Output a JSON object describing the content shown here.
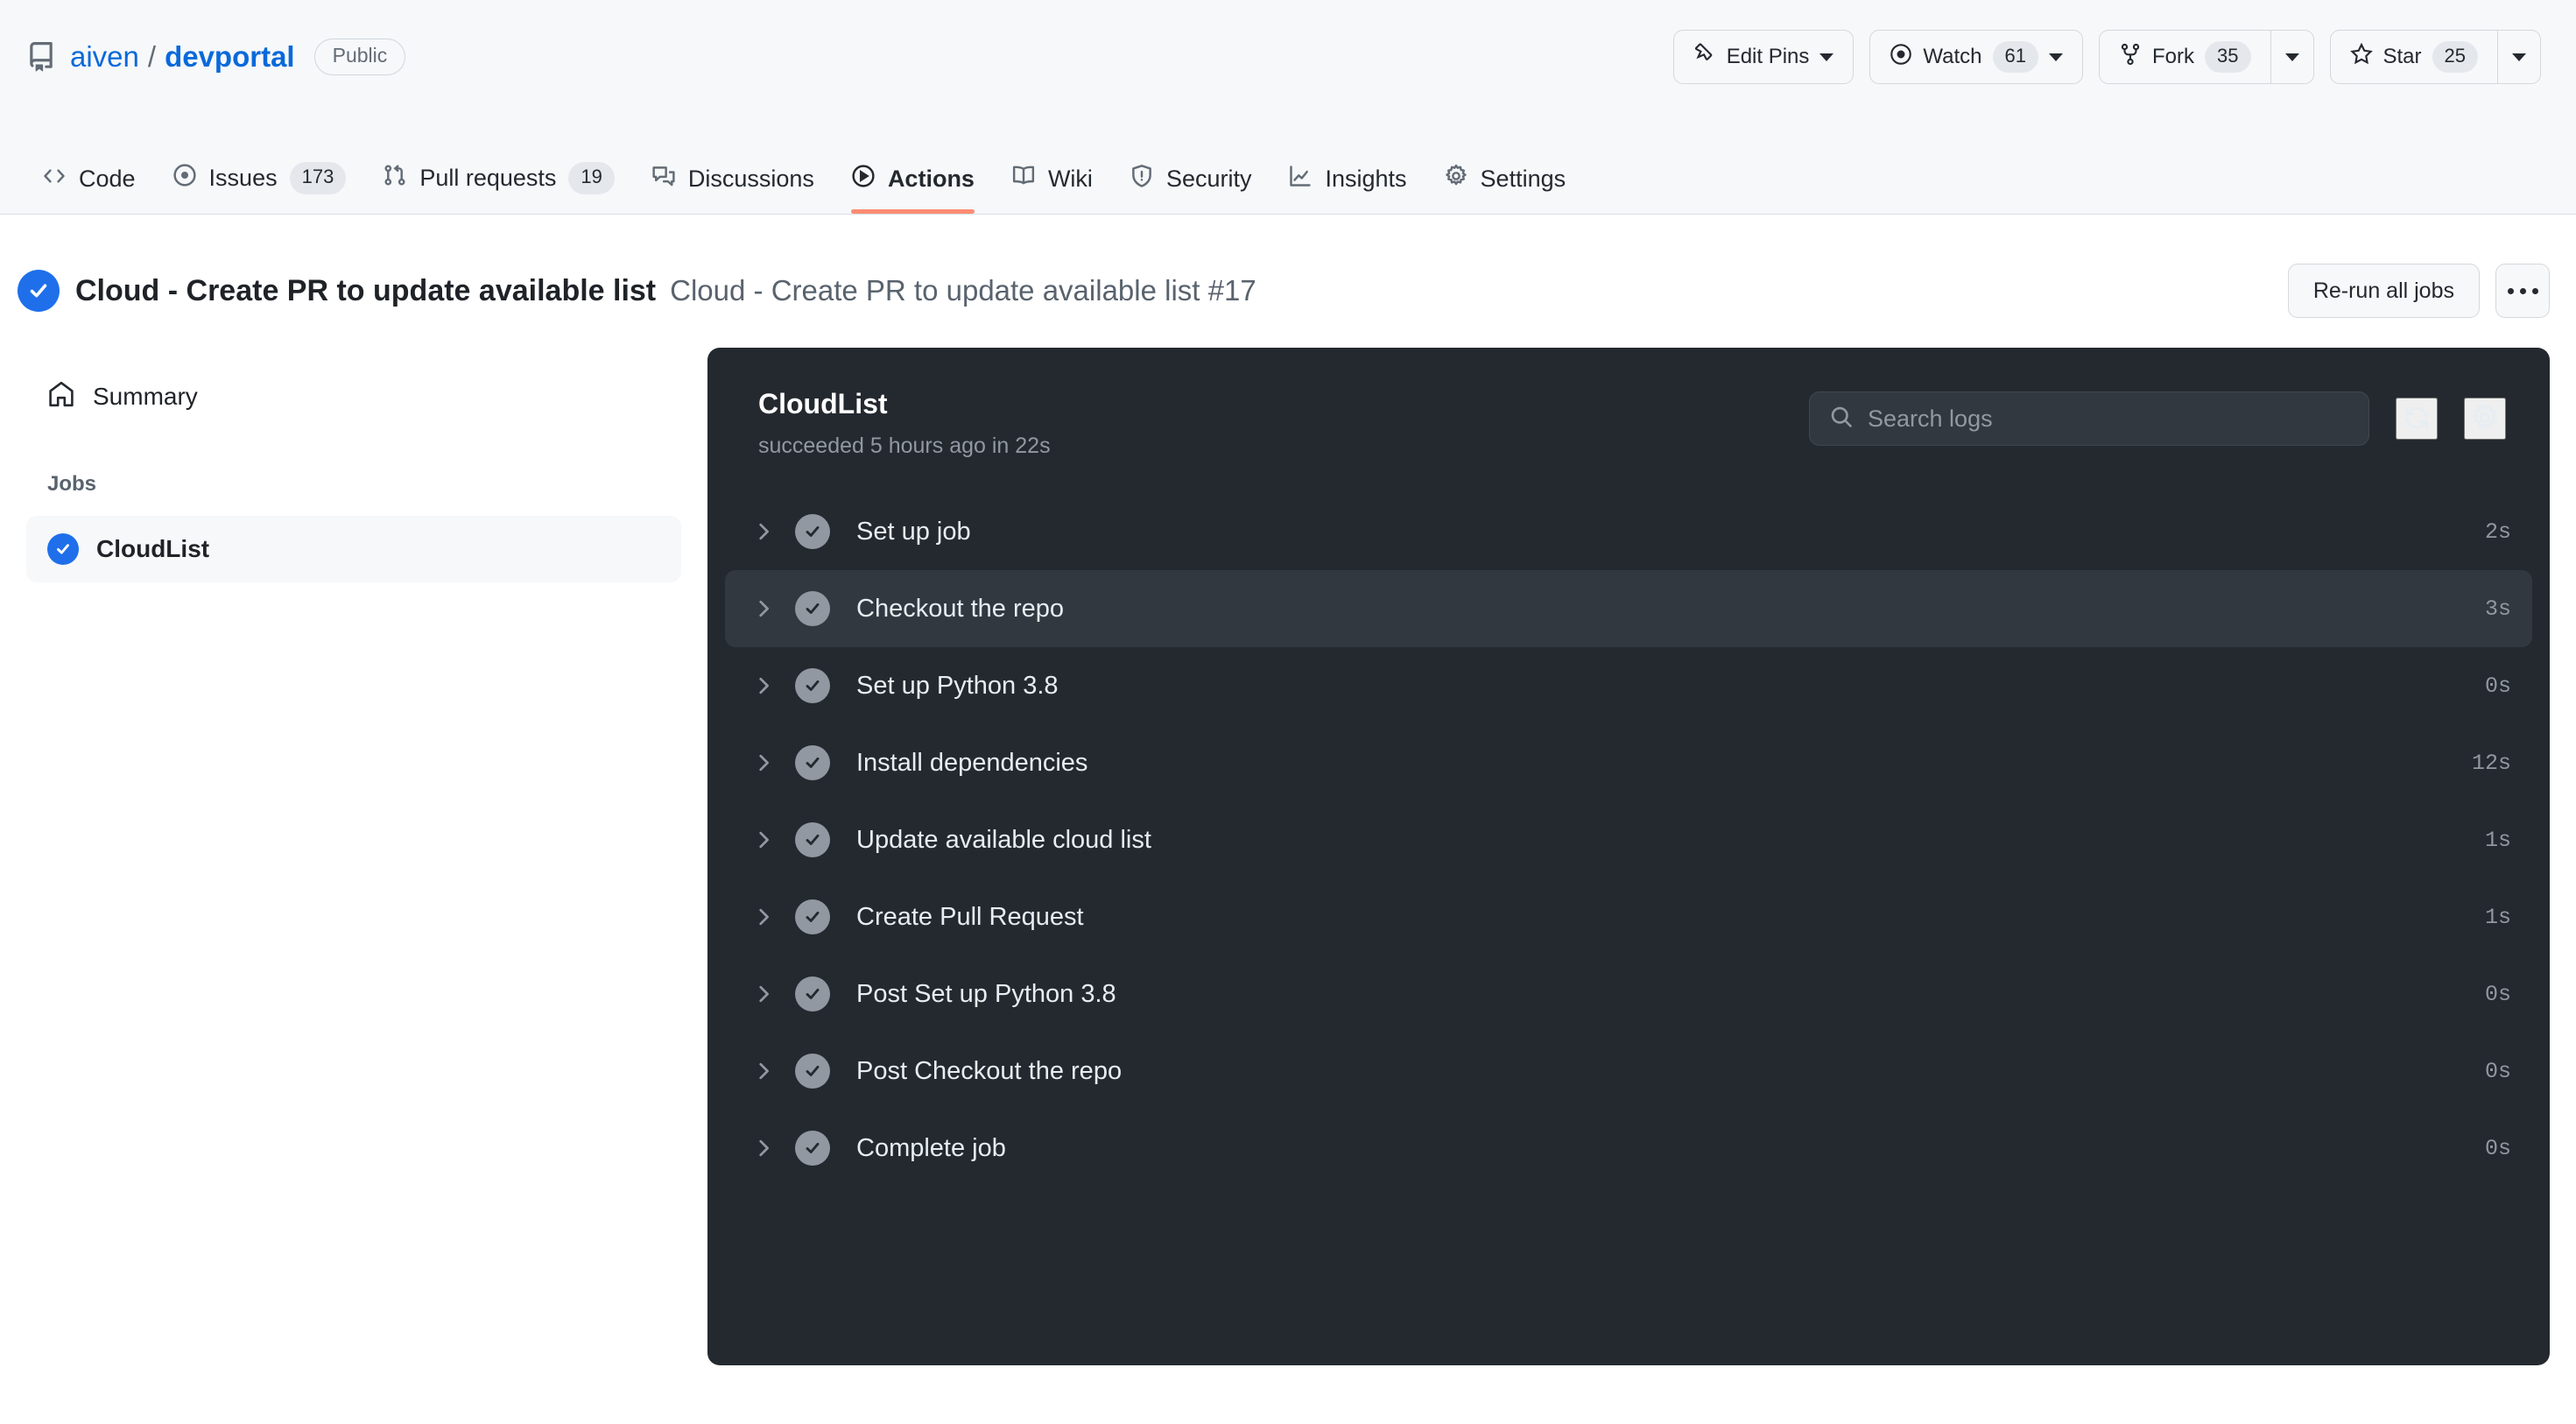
{
  "repo": {
    "icon": "repo-icon",
    "owner": "aiven",
    "separator": "/",
    "name": "devportal",
    "visibility": "Public"
  },
  "repo_actions": {
    "edit_pins": {
      "label": "Edit Pins",
      "icon": "pin-icon"
    },
    "watch": {
      "label": "Watch",
      "count": "61",
      "icon": "eye-icon"
    },
    "fork": {
      "label": "Fork",
      "count": "35",
      "icon": "fork-icon"
    },
    "star": {
      "label": "Star",
      "count": "25",
      "icon": "star-icon"
    }
  },
  "nav": {
    "tabs": [
      {
        "label": "Code",
        "icon": "code-icon",
        "count": "",
        "active": false
      },
      {
        "label": "Issues",
        "icon": "issue-opened-icon",
        "count": "173",
        "active": false
      },
      {
        "label": "Pull requests",
        "icon": "git-pull-request-icon",
        "count": "19",
        "active": false
      },
      {
        "label": "Discussions",
        "icon": "comment-discussion-icon",
        "count": "",
        "active": false
      },
      {
        "label": "Actions",
        "icon": "play-icon",
        "count": "",
        "active": true
      },
      {
        "label": "Wiki",
        "icon": "book-icon",
        "count": "",
        "active": false
      },
      {
        "label": "Security",
        "icon": "shield-icon",
        "count": "",
        "active": false
      },
      {
        "label": "Insights",
        "icon": "graph-icon",
        "count": "",
        "active": false
      },
      {
        "label": "Settings",
        "icon": "gear-icon",
        "count": "",
        "active": false
      }
    ]
  },
  "run_header": {
    "status_icon": "check-circle-icon",
    "title": "Cloud - Create PR to update available list",
    "subtitle": "Cloud - Create PR to update available list #17",
    "rerun_label": "Re-run all jobs",
    "kebab_icon": "kebab-horizontal-icon"
  },
  "sidebar": {
    "summary": {
      "label": "Summary",
      "icon": "home-icon"
    },
    "jobs_heading": "Jobs",
    "jobs": [
      {
        "label": "CloudList",
        "status_icon": "check-circle-fill-icon",
        "selected": true
      }
    ]
  },
  "log_panel": {
    "job_name": "CloudList",
    "job_meta": "succeeded 5 hours ago in 22s",
    "search": {
      "placeholder": "Search logs",
      "value": "",
      "icon": "search-icon"
    },
    "refresh_icon": "sync-icon",
    "settings_icon": "gear-icon",
    "steps": [
      {
        "name": "Set up job",
        "duration": "2s",
        "status_icon": "check-circle-icon",
        "chevron": "chevron-right-icon",
        "hovered": false
      },
      {
        "name": "Checkout the repo",
        "duration": "3s",
        "status_icon": "check-circle-icon",
        "chevron": "chevron-right-icon",
        "hovered": true
      },
      {
        "name": "Set up Python 3.8",
        "duration": "0s",
        "status_icon": "check-circle-icon",
        "chevron": "chevron-right-icon",
        "hovered": false
      },
      {
        "name": "Install dependencies",
        "duration": "12s",
        "status_icon": "check-circle-icon",
        "chevron": "chevron-right-icon",
        "hovered": false
      },
      {
        "name": "Update available cloud list",
        "duration": "1s",
        "status_icon": "check-circle-icon",
        "chevron": "chevron-right-icon",
        "hovered": false
      },
      {
        "name": "Create Pull Request",
        "duration": "1s",
        "status_icon": "check-circle-icon",
        "chevron": "chevron-right-icon",
        "hovered": false
      },
      {
        "name": "Post Set up Python 3.8",
        "duration": "0s",
        "status_icon": "check-circle-icon",
        "chevron": "chevron-right-icon",
        "hovered": false
      },
      {
        "name": "Post Checkout the repo",
        "duration": "0s",
        "status_icon": "check-circle-icon",
        "chevron": "chevron-right-icon",
        "hovered": false
      },
      {
        "name": "Complete job",
        "duration": "0s",
        "status_icon": "check-circle-icon",
        "chevron": "chevron-right-icon",
        "hovered": false
      }
    ]
  },
  "colors": {
    "accent": "#0969da",
    "success": "#1f6feb",
    "active_tab_underline": "#fd8c73",
    "panel_bg": "#24292f",
    "panel_row_hover": "#32383f",
    "header_bg": "#f6f8fa"
  }
}
